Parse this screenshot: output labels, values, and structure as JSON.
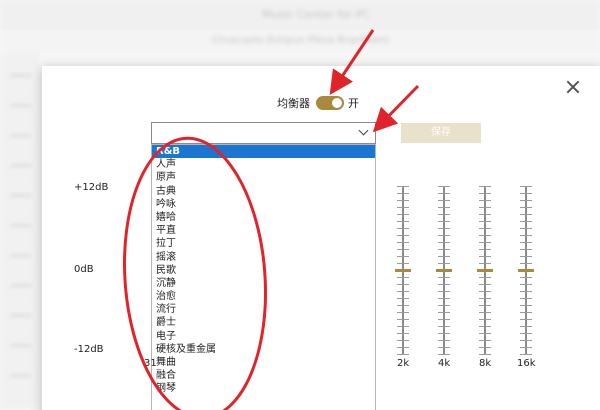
{
  "background": {
    "title": "Music Center for PC",
    "subtitle": "Chuscasto Entipus Pikna Branfioero"
  },
  "dialog": {
    "equalizer_label": "均衡器",
    "toggle_state": "开",
    "selected_preset": "R&B",
    "save_label": "保存",
    "presets": [
      "R&B",
      "人声",
      "原声",
      "古典",
      "吟咏",
      "嬉哈",
      "平直",
      "拉丁",
      "摇滚",
      "民歌",
      "沉静",
      "治愈",
      "流行",
      "爵士",
      "电子",
      "硬核及重金属",
      "舞曲",
      "融合",
      "钢琴"
    ],
    "db_labels": {
      "top": "+12dB",
      "mid": "0dB",
      "bottom": "-12dB"
    },
    "freq_partial": "31",
    "frequencies": [
      "2k",
      "4k",
      "8k",
      "16k"
    ],
    "levels_db": [
      0,
      0,
      0,
      0
    ]
  },
  "colors": {
    "accent": "#a88a3e",
    "selection": "#1b76d1",
    "annotation": "#e0242a"
  }
}
